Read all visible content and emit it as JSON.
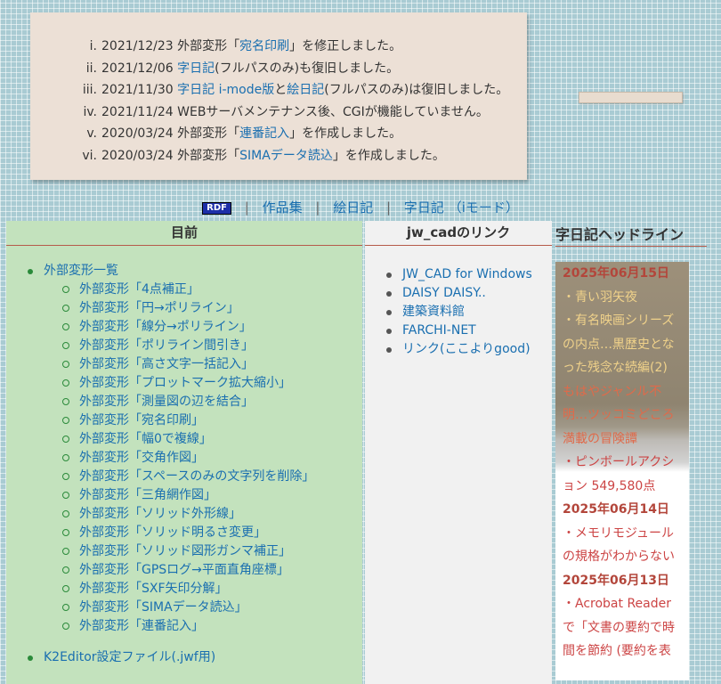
{
  "news": [
    {
      "num": "i.",
      "parts": [
        "2021/12/23 外部変形「",
        "宛名印刷",
        "」を修正しました。"
      ]
    },
    {
      "num": "ii.",
      "parts": [
        "2021/12/06 ",
        "字日記",
        "(フルパスのみ)も復旧しました。"
      ]
    },
    {
      "num": "iii.",
      "parts": [
        "2021/11/30 ",
        "字日記 i-mode版",
        "と",
        "絵日記",
        "(フルパスのみ)は復旧しました。"
      ]
    },
    {
      "num": "iv.",
      "parts": [
        "2021/11/24 WEBサーバメンテナンス後、CGIが機能していません。"
      ]
    },
    {
      "num": "v.",
      "parts": [
        "2020/03/24 外部変形「",
        "連番記入",
        "」を作成しました。"
      ]
    },
    {
      "num": "vi.",
      "parts": [
        "2020/03/24 外部変形「",
        "SIMAデータ読込",
        "」を作成しました。"
      ]
    }
  ],
  "menu": {
    "rdf": "RDF",
    "items": [
      "作品集",
      "絵日記",
      "字日記",
      "（iモード）"
    ]
  },
  "toc": {
    "title": "目前",
    "top1": "外部変形一覧",
    "items": [
      "外部変形「4点補正」",
      "外部変形「円→ポリライン」",
      "外部変形「線分→ポリライン」",
      "外部変形「ポリライン間引き」",
      "外部変形「高さ文字一括記入」",
      "外部変形「プロットマーク拡大縮小」",
      "外部変形「測量図の辺を結合」",
      "外部変形「宛名印刷」",
      "外部変形「幅0で複線」",
      "外部変形「交角作図」",
      "外部変形「スペースのみの文字列を削除」",
      "外部変形「三角網作図」",
      "外部変形「ソリッド外形線」",
      "外部変形「ソリッド明るさ変更」",
      "外部変形「ソリッド図形ガンマ補正」",
      "外部変形「GPSログ→平面直角座標」",
      "外部変形「SXF矢印分解」",
      "外部変形「SIMAデータ読込」",
      "外部変形「連番記入」"
    ],
    "top2": "K2Editor設定ファイル(.jwf用)"
  },
  "links": {
    "title": "jw_cadのリンク",
    "items": [
      "JW_CAD for Windows",
      "DAISY DAISY..",
      "建築資料館",
      "FARCHI-NET",
      "リンク(ここよりgood)"
    ]
  },
  "headline": {
    "title": "字日記ヘッドライン",
    "lines": [
      {
        "kind": "date",
        "text": "2025年06月15日"
      },
      {
        "kind": "b1",
        "text": "・青い羽矢夜"
      },
      {
        "kind": "b1",
        "text": "・有名映画シリーズ"
      },
      {
        "kind": "b1",
        "text": "の内点…黒歴史とな"
      },
      {
        "kind": "b1",
        "text": "った残念な続編(2)"
      },
      {
        "kind": "b2",
        "text": "もはやジャンル不"
      },
      {
        "kind": "b2",
        "text": "明…ツッコミどころ"
      },
      {
        "kind": "b2",
        "text": "満載の冒険譚"
      },
      {
        "kind": "body",
        "text": "・ピンボールアクシ"
      },
      {
        "kind": "body",
        "text": "ョン 549,580点"
      },
      {
        "kind": "date",
        "text": "2025年06月14日"
      },
      {
        "kind": "body",
        "text": "・メモリモジュール"
      },
      {
        "kind": "body",
        "text": "の規格がわからない"
      },
      {
        "kind": "date",
        "text": "2025年06月13日"
      },
      {
        "kind": "body",
        "text": "・Acrobat Reader"
      },
      {
        "kind": "body",
        "text": "で「文書の要約で時"
      },
      {
        "kind": "body",
        "text": "間を節約 (要約を表"
      }
    ]
  }
}
